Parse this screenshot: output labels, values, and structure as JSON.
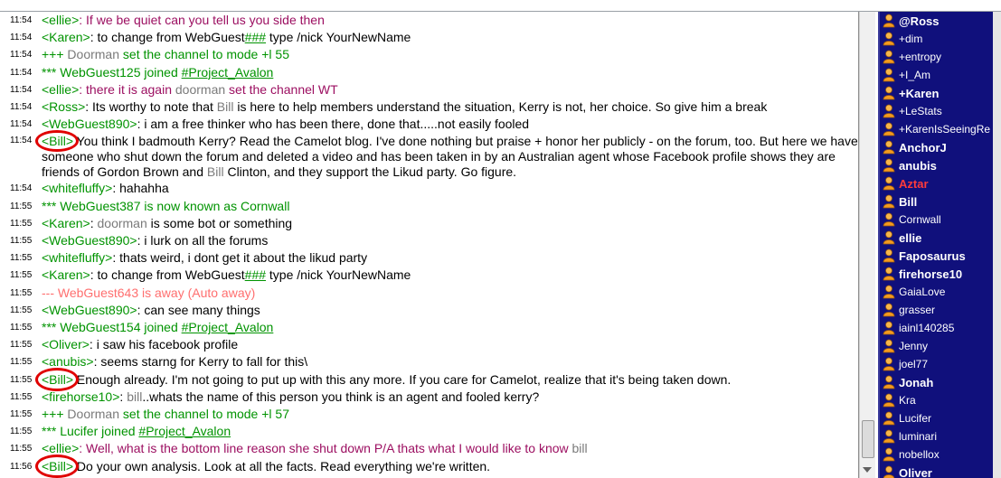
{
  "chat": [
    {
      "t": "11:54",
      "parts": [
        [
          "nick",
          "<ellie>"
        ],
        [
          "pink",
          ": If we be quiet can you tell us you side then"
        ]
      ]
    },
    {
      "t": "11:54",
      "parts": [
        [
          "nick",
          "<Karen>"
        ],
        [
          "plain",
          ": to change from WebGuest"
        ],
        [
          "joinlink",
          "###"
        ],
        [
          "plain",
          " type /nick YourNewName"
        ]
      ]
    },
    {
      "t": "11:54",
      "parts": [
        [
          "action",
          "+++ "
        ],
        [
          "hl",
          "Doorman"
        ],
        [
          "action",
          " set the channel to mode +l 55"
        ]
      ]
    },
    {
      "t": "11:54",
      "parts": [
        [
          "action",
          "*** WebGuest125 joined "
        ],
        [
          "joinlink",
          "#Project_Avalon"
        ]
      ]
    },
    {
      "t": "11:54",
      "parts": [
        [
          "nick",
          "<ellie>"
        ],
        [
          "pink",
          ": there it is again "
        ],
        [
          "hl",
          "doorman"
        ],
        [
          "pink",
          " set the channel WT"
        ]
      ]
    },
    {
      "t": "11:54",
      "parts": [
        [
          "nick",
          "<Ross>"
        ],
        [
          "plain",
          ": Its worthy to note that "
        ],
        [
          "hl",
          "Bill"
        ],
        [
          "plain",
          " is here to help members understand the situation, Kerry is not, her choice. So give him a break"
        ]
      ]
    },
    {
      "t": "11:54",
      "parts": [
        [
          "nick",
          "<WebGuest890>"
        ],
        [
          "plain",
          ": i am a free thinker who has been there, done that.....not easily fooled"
        ]
      ]
    },
    {
      "t": "11:54",
      "wrapped": true,
      "circled": "<Bill>",
      "parts": [
        [
          "plain",
          " You think I badmouth Kerry? Read the Camelot blog. I've done nothing but praise + honor her publicly - on the forum, too. But here we have someone who shut down the forum and deleted a video and has been taken in by an Australian agent whose Facebook profile shows they are friends of Gordon Brown and "
        ],
        [
          "hl",
          "Bill"
        ],
        [
          "plain",
          " Clinton, and they support the Likud party. Go figure."
        ]
      ]
    },
    {
      "t": "11:54",
      "parts": [
        [
          "nick",
          "<whitefluffy>"
        ],
        [
          "plain",
          ": hahahha"
        ]
      ]
    },
    {
      "t": "11:55",
      "parts": [
        [
          "action",
          "*** WebGuest387 is now known as Cornwall"
        ]
      ]
    },
    {
      "t": "11:55",
      "parts": [
        [
          "nick",
          "<Karen>"
        ],
        [
          "plain",
          ": "
        ],
        [
          "hl",
          "doorman"
        ],
        [
          "plain",
          " is some bot or something"
        ]
      ]
    },
    {
      "t": "11:55",
      "parts": [
        [
          "nick",
          "<WebGuest890>"
        ],
        [
          "plain",
          ": i lurk on all the forums"
        ]
      ]
    },
    {
      "t": "11:55",
      "parts": [
        [
          "nick",
          "<whitefluffy>"
        ],
        [
          "plain",
          ": thats weird, i dont get it about the likud party"
        ]
      ]
    },
    {
      "t": "11:55",
      "parts": [
        [
          "nick",
          "<Karen>"
        ],
        [
          "plain",
          ": to change from WebGuest"
        ],
        [
          "joinlink",
          "###"
        ],
        [
          "plain",
          " type /nick YourNewName"
        ]
      ]
    },
    {
      "t": "11:55",
      "parts": [
        [
          "away",
          "--- WebGuest643 is away (Auto away)"
        ]
      ]
    },
    {
      "t": "11:55",
      "parts": [
        [
          "nick",
          "<WebGuest890>"
        ],
        [
          "plain",
          ": can see many things"
        ]
      ]
    },
    {
      "t": "11:55",
      "parts": [
        [
          "action",
          "*** WebGuest154 joined "
        ],
        [
          "joinlink",
          "#Project_Avalon"
        ]
      ]
    },
    {
      "t": "11:55",
      "parts": [
        [
          "nick",
          "<Oliver>"
        ],
        [
          "plain",
          ": i saw his facebook profile"
        ]
      ]
    },
    {
      "t": "11:55",
      "parts": [
        [
          "nick",
          "<anubis>"
        ],
        [
          "plain",
          ": seems starng for Kerry to fall for this\\"
        ]
      ]
    },
    {
      "t": "11:55",
      "circled": "<Bill>",
      "parts": [
        [
          "plain",
          " Enough already. I'm not going to put up with this any more. If you care for Camelot, realize that it's being taken down."
        ]
      ]
    },
    {
      "t": "11:55",
      "parts": [
        [
          "nick",
          "<firehorse10>"
        ],
        [
          "plain",
          ": "
        ],
        [
          "hl",
          "bill"
        ],
        [
          "plain",
          "..whats the name of this  person you think is an agent and fooled kerry?"
        ]
      ]
    },
    {
      "t": "11:55",
      "parts": [
        [
          "action",
          "+++ "
        ],
        [
          "hl",
          "Doorman"
        ],
        [
          "action",
          " set the channel to mode +l 57"
        ]
      ]
    },
    {
      "t": "11:55",
      "parts": [
        [
          "action",
          "*** Lucifer joined "
        ],
        [
          "joinlink",
          "#Project_Avalon"
        ]
      ]
    },
    {
      "t": "11:55",
      "parts": [
        [
          "nick",
          "<ellie>"
        ],
        [
          "pink",
          ": Well, what is the bottom line reason she shut down P/A thats what I would like to know "
        ],
        [
          "hl",
          "bill"
        ]
      ]
    },
    {
      "t": "11:56",
      "circled": "<Bill>",
      "parts": [
        [
          "plain",
          " Do your own analysis. Look at all the facts. Read everything we're written."
        ]
      ]
    }
  ],
  "users": [
    {
      "name": "@Ross",
      "bold": true
    },
    {
      "name": "+dim"
    },
    {
      "name": "+entropy"
    },
    {
      "name": "+I_Am"
    },
    {
      "name": "+Karen",
      "bold": true
    },
    {
      "name": "+LeStats"
    },
    {
      "name": "+KarenIsSeeingRe"
    },
    {
      "name": "AnchorJ",
      "bold": true
    },
    {
      "name": "anubis",
      "bold": true
    },
    {
      "name": "Aztar",
      "bold": true,
      "red": true
    },
    {
      "name": "Bill",
      "bold": true
    },
    {
      "name": "Cornwall"
    },
    {
      "name": "ellie",
      "bold": true
    },
    {
      "name": "Faposaurus",
      "bold": true
    },
    {
      "name": "firehorse10",
      "bold": true
    },
    {
      "name": "GaiaLove"
    },
    {
      "name": "grasser"
    },
    {
      "name": "iainl140285"
    },
    {
      "name": "Jenny"
    },
    {
      "name": "joel77"
    },
    {
      "name": "Jonah",
      "bold": true
    },
    {
      "name": "Kra"
    },
    {
      "name": "Lucifer"
    },
    {
      "name": "luminari"
    },
    {
      "name": "nobellox"
    },
    {
      "name": "Oliver",
      "bold": true
    }
  ],
  "colors": {
    "nicklist_bg": "#10107c",
    "circle": "#e00000",
    "nick": "#009300",
    "pink": "#9c0f61"
  }
}
